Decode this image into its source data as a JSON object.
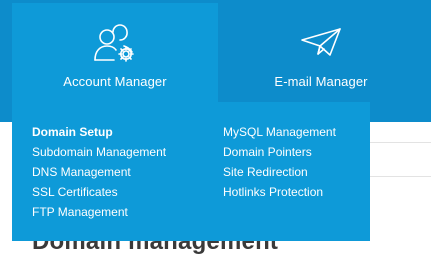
{
  "nav": {
    "tabs": [
      {
        "label": "Account Manager",
        "icon": "users-gear-icon"
      },
      {
        "label": "E-mail Manager",
        "icon": "paper-plane-icon"
      }
    ]
  },
  "dropdown": {
    "left_items": [
      {
        "label": "Domain Setup",
        "active": true
      },
      {
        "label": "Subdomain Management"
      },
      {
        "label": "DNS Management"
      },
      {
        "label": "SSL Certificates"
      },
      {
        "label": "FTP Management"
      }
    ],
    "right_items": [
      {
        "label": "MySQL Management"
      },
      {
        "label": "Domain Pointers"
      },
      {
        "label": "Site Redirection"
      },
      {
        "label": "Hotlinks Protection"
      }
    ]
  },
  "page": {
    "title": "Domain management"
  },
  "colors": {
    "nav_bg": "#0d8ccb",
    "active_bg": "#0e9ad8",
    "text": "#ffffff"
  }
}
